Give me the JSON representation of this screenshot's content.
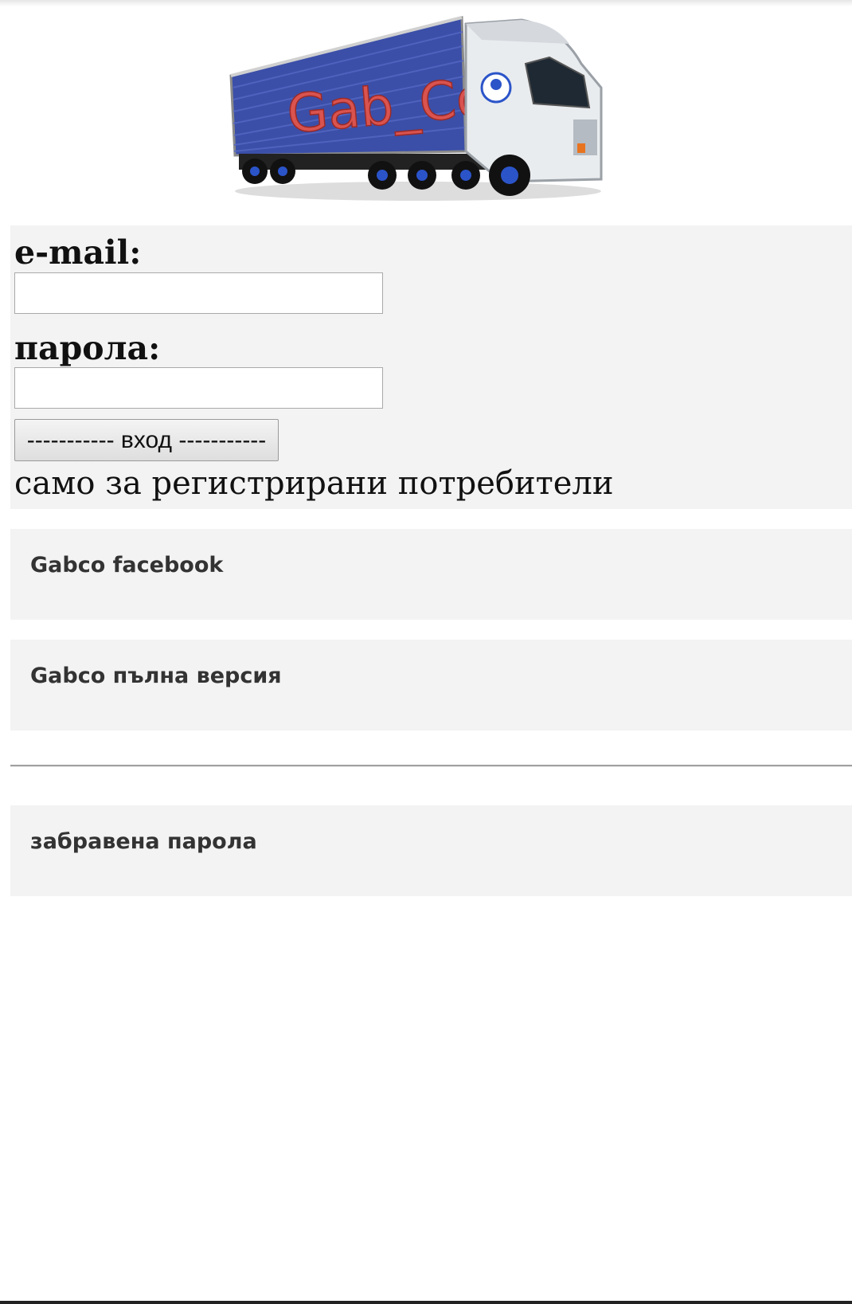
{
  "logo": {
    "text": "Gab_Co",
    "colors": {
      "trailer": "#3b4fa8",
      "text": "#d9534f",
      "cab": "#e9ecef"
    }
  },
  "login": {
    "email_label": "e-mail:",
    "email_value": "",
    "password_label": "парола:",
    "password_value": "",
    "button_label": "----------- вход -----------",
    "note": "само за регистрирани потребители"
  },
  "links": {
    "facebook": "Gabco facebook",
    "full_version": "Gabco пълна версия",
    "forgot_password": "забравена парола"
  },
  "colors": {
    "panel_bg": "#f3f3f3",
    "link_text": "#333333"
  }
}
